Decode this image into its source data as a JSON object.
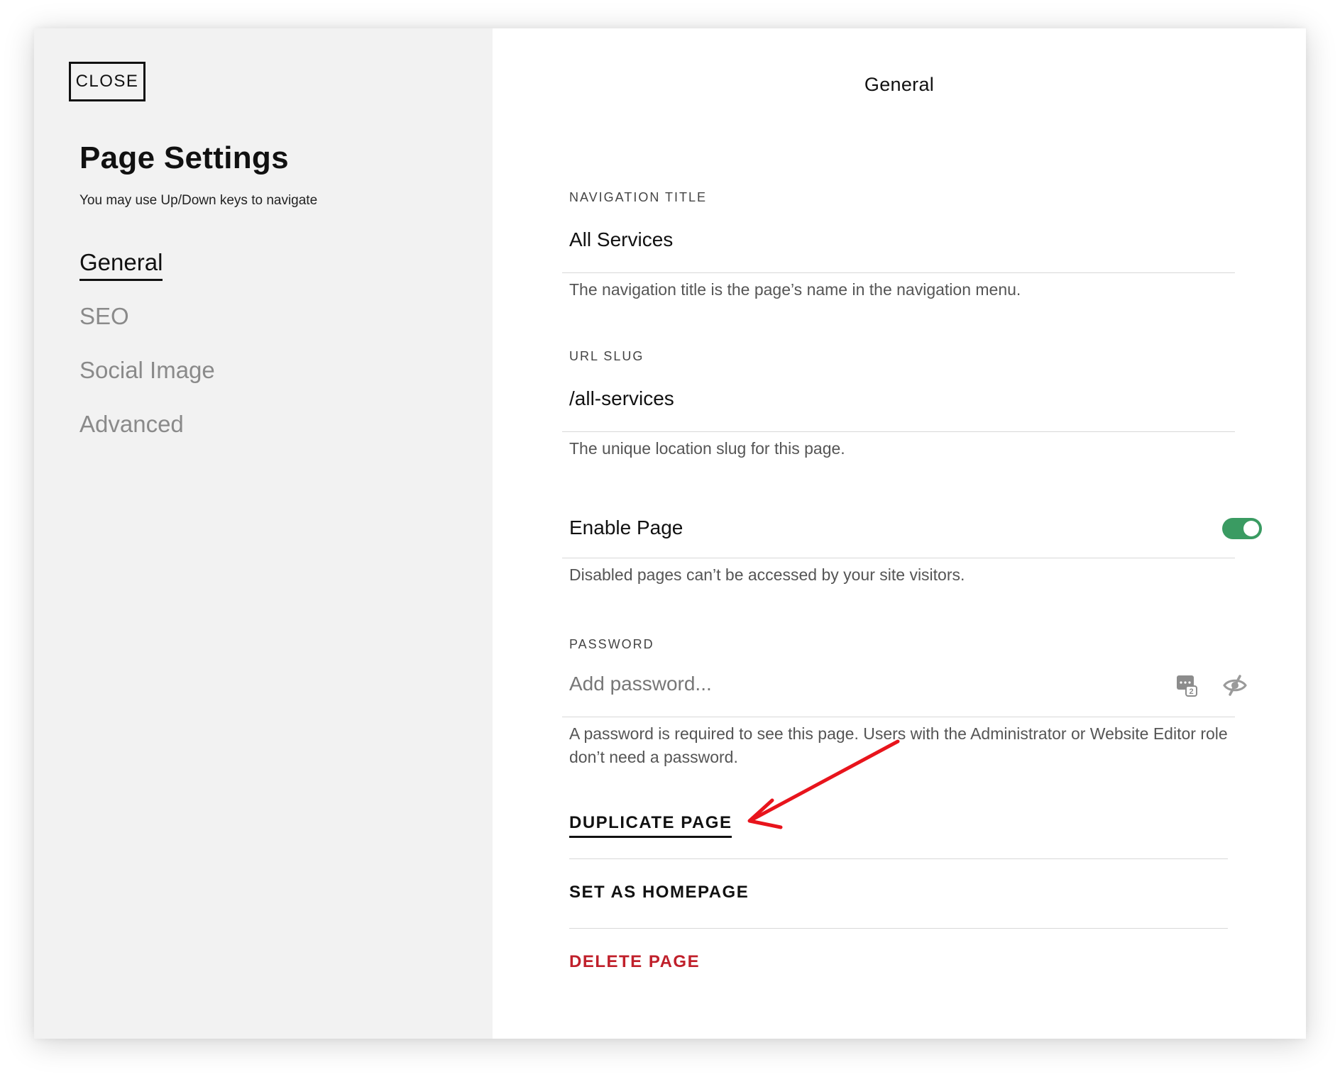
{
  "sidebar": {
    "close_label": "CLOSE",
    "title": "Page Settings",
    "hint": "You may use Up/Down keys to navigate",
    "nav": [
      {
        "label": "General",
        "active": true
      },
      {
        "label": "SEO",
        "active": false
      },
      {
        "label": "Social Image",
        "active": false
      },
      {
        "label": "Advanced",
        "active": false
      }
    ]
  },
  "main": {
    "title": "General",
    "navigation_title": {
      "label": "NAVIGATION TITLE",
      "value": "All Services",
      "help": "The navigation title is the page’s name in the navigation menu."
    },
    "url_slug": {
      "label": "URL SLUG",
      "value": "/all-services",
      "help": "The unique location slug for this page."
    },
    "enable_page": {
      "label": "Enable Page",
      "enabled": true,
      "help": "Disabled pages can’t be accessed by your site visitors."
    },
    "password": {
      "label": "PASSWORD",
      "placeholder": "Add password...",
      "help": "A password is required to see this page. Users with the Administrator or Website Editor role don’t need a password."
    },
    "actions": {
      "duplicate": "DUPLICATE PAGE",
      "set_homepage": "SET AS HOMEPAGE",
      "delete": "DELETE PAGE"
    }
  },
  "colors": {
    "sidebar_bg": "#f2f2f2",
    "toggle_on": "#3a9b62",
    "danger": "#c0202b",
    "annotation_arrow": "#e8141c"
  },
  "icons": {
    "password_generator": "password-generator-icon",
    "visibility": "eye-slash-icon"
  }
}
